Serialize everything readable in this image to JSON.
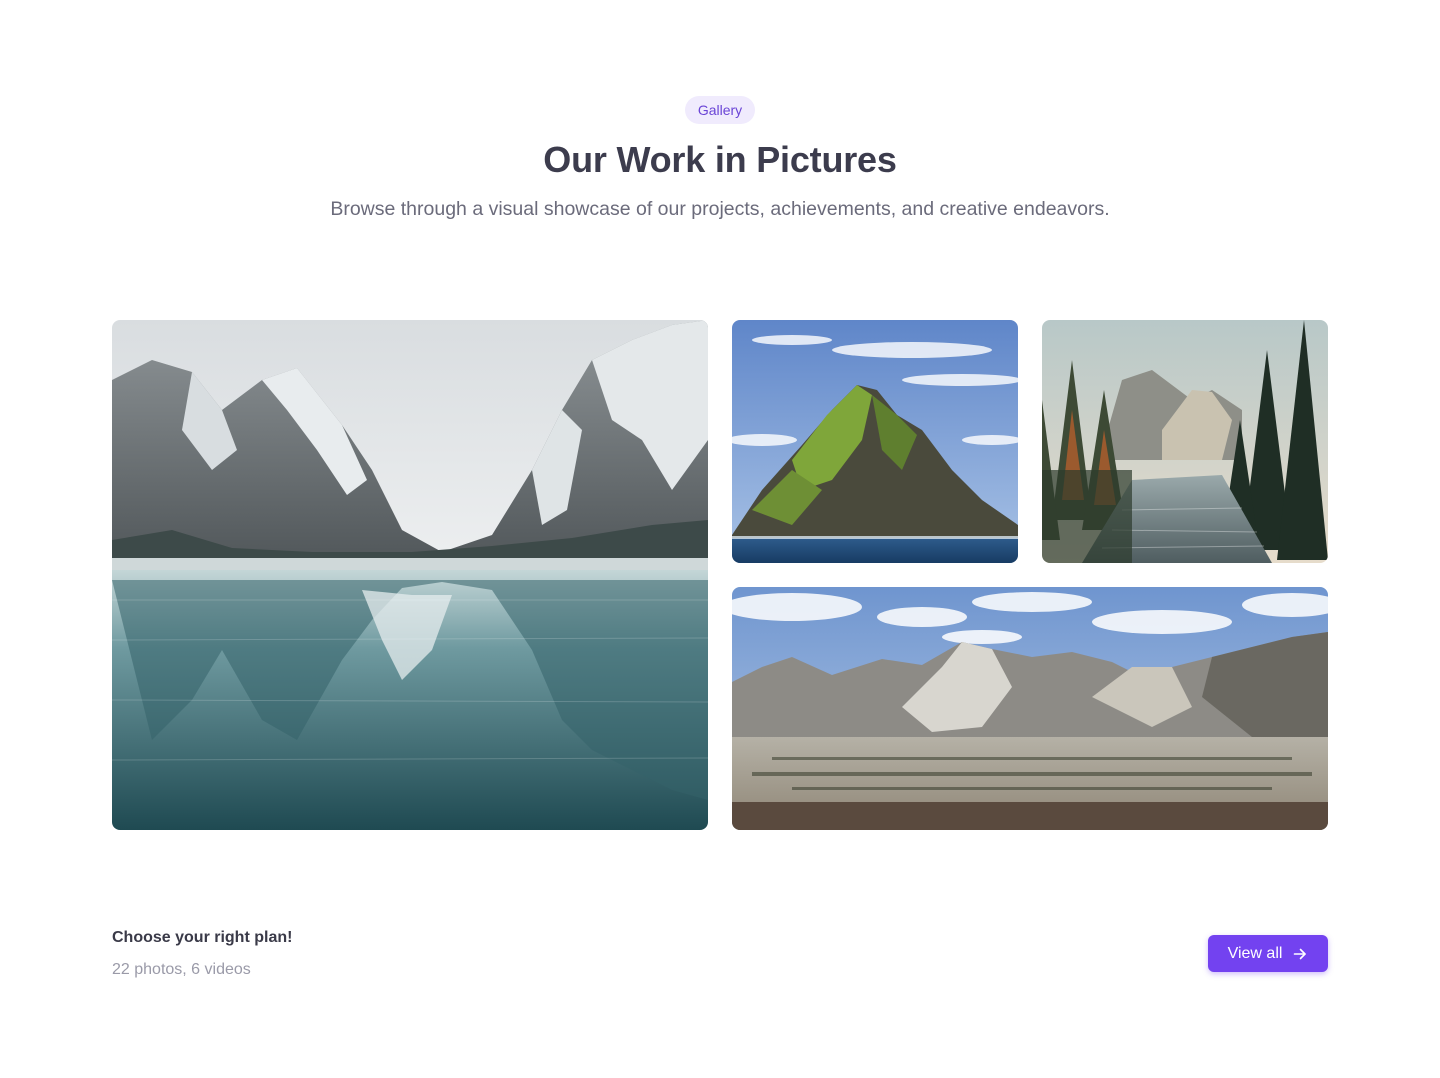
{
  "header": {
    "badge": "Gallery",
    "title": "Our Work in Pictures",
    "subtitle": "Browse through a visual showcase of our projects, achievements, and creative endeavors."
  },
  "gallery": {
    "images": [
      {
        "name": "snowy-mountain-lake"
      },
      {
        "name": "green-rocky-island"
      },
      {
        "name": "forest-river"
      },
      {
        "name": "mountain-range-panorama"
      }
    ]
  },
  "footer": {
    "title": "Choose your right plan!",
    "meta": "22 photos, 6 videos",
    "button_label": "View all",
    "button_icon": "arrow-right-icon"
  },
  "colors": {
    "accent": "#7342f0",
    "badge_bg": "#f0ebfd",
    "badge_text": "#6a44d6"
  }
}
